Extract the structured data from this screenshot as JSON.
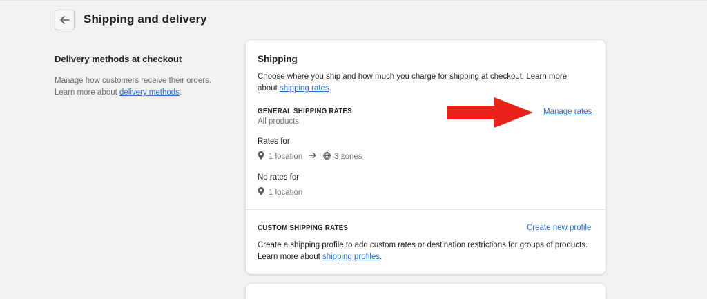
{
  "header": {
    "title": "Shipping and delivery"
  },
  "section": {
    "title": "Delivery methods at checkout",
    "desc_line1": "Manage how customers receive their orders.",
    "desc_line2_prefix": "Learn more about ",
    "desc_link": "delivery methods",
    "desc_suffix": "."
  },
  "shipping_card": {
    "title": "Shipping",
    "desc_prefix": "Choose where you ship and how much you charge for shipping at checkout. Learn more about ",
    "desc_link": "shipping rates",
    "desc_suffix": ".",
    "general": {
      "heading": "GENERAL SHIPPING RATES",
      "scope": "All products",
      "action": "Manage rates",
      "rates_for_label": "Rates for",
      "rates_for_locations": "1 location",
      "rates_for_zones": "3 zones",
      "no_rates_for_label": "No rates for",
      "no_rates_locations": "1 location"
    },
    "custom": {
      "heading": "CUSTOM SHIPPING RATES",
      "action": "Create new profile",
      "desc_prefix": "Create a shipping profile to add custom rates or destination restrictions for groups of products. Learn more about ",
      "desc_link": "shipping profiles",
      "desc_suffix": "."
    }
  },
  "icons": {
    "back": "arrow-left-icon",
    "location": "location-pin-icon",
    "arrow": "arrow-right-icon",
    "globe": "globe-icon",
    "annotation": "red-arrow-annotation"
  },
  "colors": {
    "link": "#2c6ecb",
    "annotation_arrow": "#e8231a",
    "background": "#f1f1f1"
  }
}
